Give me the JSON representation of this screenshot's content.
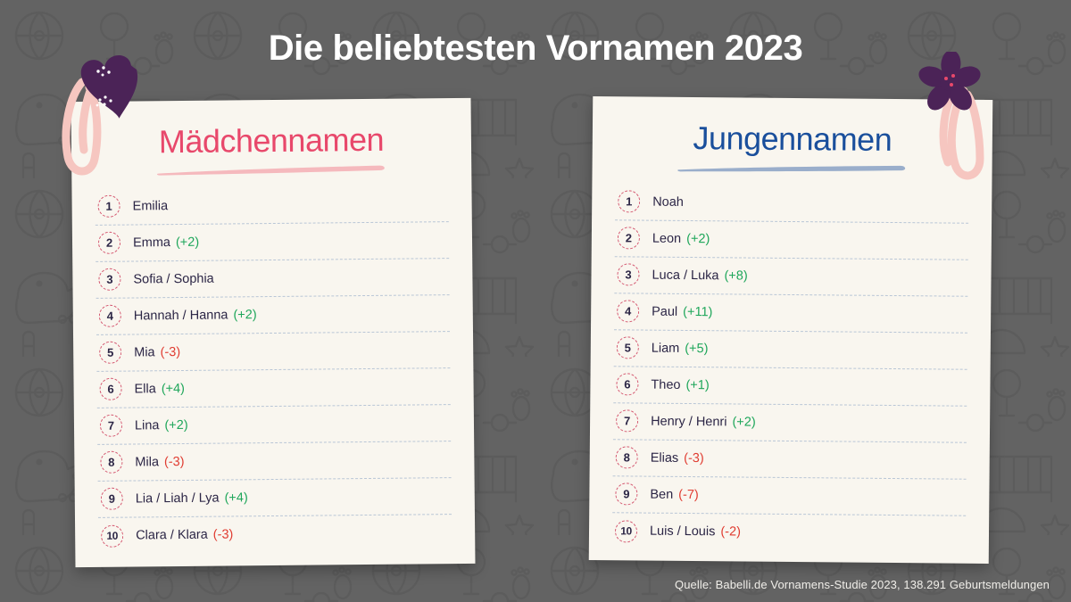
{
  "page": {
    "title": "Die beliebtesten Vornamen 2023",
    "source_note": "Quelle: Babelli.de Vornamens-Studie 2023, 138.291 Geburtsmeldungen",
    "background_color": "#636363",
    "card_color": "#f9f6ef",
    "title_color": "#ffffff"
  },
  "colors": {
    "girls_accent": "#e8486b",
    "boys_accent": "#1a4f9c",
    "girls_brush": "#f5b9bd",
    "boys_brush": "#9aaecb",
    "name_text": "#2b2545",
    "rank_ring": "#d4566f",
    "delta_up": "#1ea65a",
    "delta_down": "#e03c31",
    "separator": "#b9c6d6",
    "clip_pink": "#f6c6c0",
    "charm_purple": "#4b2357"
  },
  "girls_card": {
    "heading": "Mädchennamen",
    "clip_icon": "heart-charm-paperclip-icon",
    "entries": [
      {
        "rank": "1",
        "name": "Emilia",
        "delta": "",
        "direction": "none"
      },
      {
        "rank": "2",
        "name": "Emma",
        "delta": "(+2)",
        "direction": "up"
      },
      {
        "rank": "3",
        "name": "Sofia / Sophia",
        "delta": "",
        "direction": "none"
      },
      {
        "rank": "4",
        "name": "Hannah / Hanna",
        "delta": "(+2)",
        "direction": "up"
      },
      {
        "rank": "5",
        "name": "Mia",
        "delta": "(-3)",
        "direction": "down"
      },
      {
        "rank": "6",
        "name": "Ella",
        "delta": "(+4)",
        "direction": "up"
      },
      {
        "rank": "7",
        "name": "Lina",
        "delta": "(+2)",
        "direction": "up"
      },
      {
        "rank": "8",
        "name": "Mila",
        "delta": "(-3)",
        "direction": "down"
      },
      {
        "rank": "9",
        "name": "Lia / Liah / Lya",
        "delta": "(+4)",
        "direction": "up"
      },
      {
        "rank": "10",
        "name": "Clara / Klara",
        "delta": "(-3)",
        "direction": "down"
      }
    ]
  },
  "boys_card": {
    "heading": "Jungennamen",
    "clip_icon": "flower-charm-paperclip-icon",
    "entries": [
      {
        "rank": "1",
        "name": "Noah",
        "delta": "",
        "direction": "none"
      },
      {
        "rank": "2",
        "name": "Leon",
        "delta": "(+2)",
        "direction": "up"
      },
      {
        "rank": "3",
        "name": "Luca / Luka",
        "delta": "(+8)",
        "direction": "up"
      },
      {
        "rank": "4",
        "name": "Paul",
        "delta": "(+11)",
        "direction": "up"
      },
      {
        "rank": "5",
        "name": "Liam",
        "delta": "(+5)",
        "direction": "up"
      },
      {
        "rank": "6",
        "name": "Theo",
        "delta": "(+1)",
        "direction": "up"
      },
      {
        "rank": "7",
        "name": "Henry / Henri",
        "delta": "(+2)",
        "direction": "up"
      },
      {
        "rank": "8",
        "name": "Elias",
        "delta": "(-3)",
        "direction": "down"
      },
      {
        "rank": "9",
        "name": "Ben",
        "delta": "(-7)",
        "direction": "down"
      },
      {
        "rank": "10",
        "name": "Luis / Louis",
        "delta": "(-2)",
        "direction": "down"
      }
    ]
  }
}
